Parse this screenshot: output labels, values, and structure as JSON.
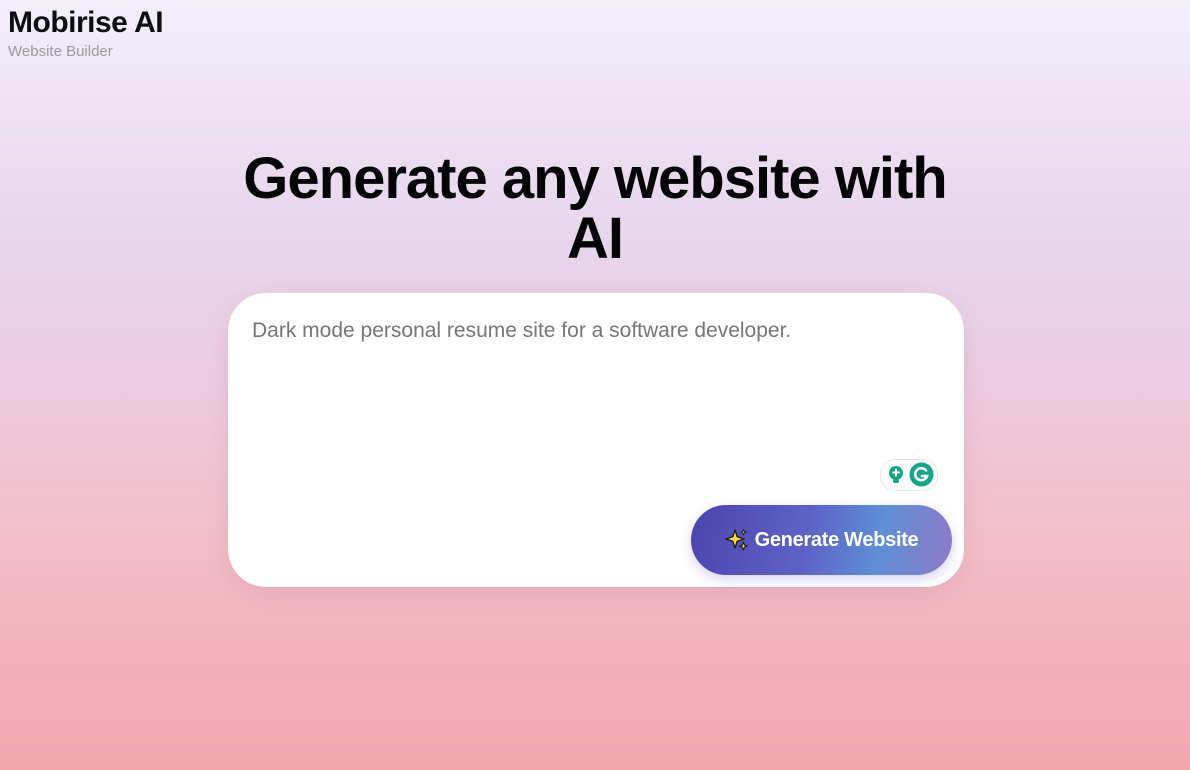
{
  "brand": {
    "name": "Mobirise AI",
    "subtitle": "Website Builder"
  },
  "hero": {
    "title_line1": "Generate any website with",
    "title_line2": "AI"
  },
  "prompt": {
    "placeholder": "Dark mode personal resume site for a software developer.",
    "value": ""
  },
  "extension": {
    "icons": [
      "lightbulb-icon",
      "grammarly-icon"
    ],
    "accent": "#15a589"
  },
  "generate_button": {
    "label": "Generate Website",
    "icon": "sparkle-icon"
  },
  "colors": {
    "background_top": "#f3f0fa",
    "background_bottom": "#f2a6ad",
    "button_start": "#4c44ad",
    "button_end": "#8f79c6",
    "headline": "#050507",
    "placeholder": "#6e7079"
  }
}
